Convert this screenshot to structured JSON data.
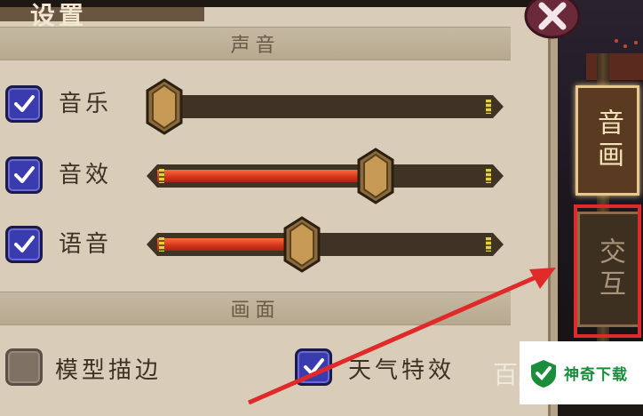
{
  "title": "设置",
  "sections": {
    "sound": "声音",
    "graphics": "画面"
  },
  "sound_rows": [
    {
      "label": "音乐",
      "checked": true,
      "level": 0.0
    },
    {
      "label": "音效",
      "checked": true,
      "level": 0.65
    },
    {
      "label": "语音",
      "checked": true,
      "level": 0.43
    }
  ],
  "graphics_options": [
    {
      "label": "模型描边",
      "checked": false
    },
    {
      "label": "天气特效",
      "checked": true
    }
  ],
  "side_tabs": [
    {
      "label": "音画",
      "active": true
    },
    {
      "label": "交互",
      "active": false
    }
  ],
  "close_icon": "close-x-icon",
  "annotation_color": "#e02a2a",
  "watermark": {
    "text": "神奇下载",
    "ghost_text": "百度"
  },
  "colors": {
    "checkbox_on": "#3b3bb0",
    "slider_fill": "#d2331c",
    "panel_bg": "#d9cdb9"
  }
}
